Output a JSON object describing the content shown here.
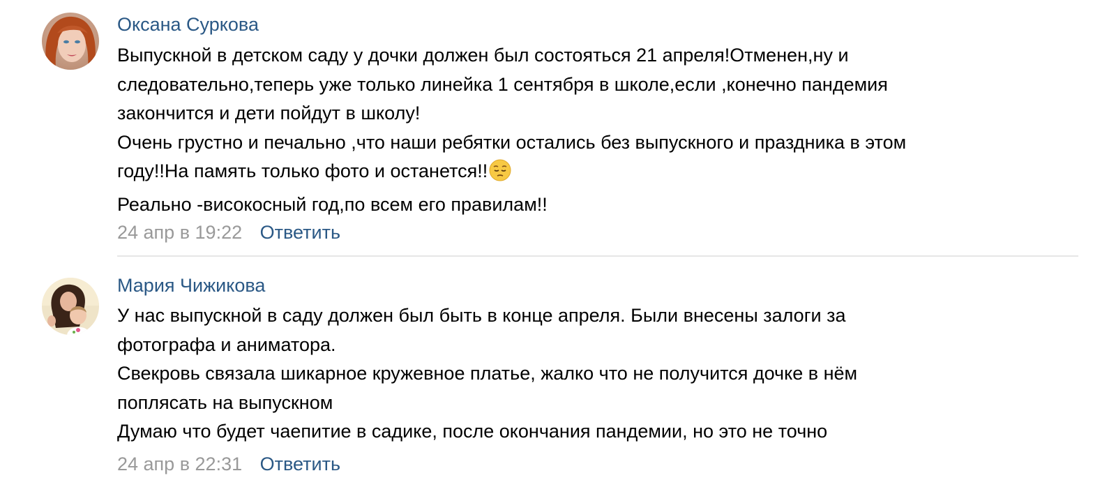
{
  "comments": [
    {
      "author": "Оксана Суркова",
      "lines": [
        "Выпускной в детском саду у дочки должен был состояться 21 апреля!Отменен,ну и",
        "следовательно,теперь уже только линейка 1 сентября в школе,если ,конечно пандемия",
        "закончится и дети пойдут в школу!",
        "Очень грустно и печально ,что наши ребятки остались без выпускного и праздника в этом",
        "году!!На память только фото и останется!!",
        "Реально -високосный год,по всем его правилам!!"
      ],
      "emoji_icon": "pensive-face-icon",
      "date": "24 апр в 19:22",
      "reply_label": "Ответить"
    },
    {
      "author": "Мария Чижикова",
      "lines": [
        "У нас выпускной в саду должен был быть в конце апреля. Были внесены залоги за",
        "фотографа и аниматора.",
        "Свекровь связала шикарное кружевное платье, жалко что не получится дочке в нём",
        "поплясать на выпускном",
        "Думаю что будет чаепитие в садике, после окончания пандемии, но это не точно"
      ],
      "date": "24 апр в 22:31",
      "reply_label": "Ответить"
    }
  ],
  "colors": {
    "link": "#2a5885",
    "text": "#000000",
    "meta": "#999999",
    "separator": "#e6e6e6"
  }
}
